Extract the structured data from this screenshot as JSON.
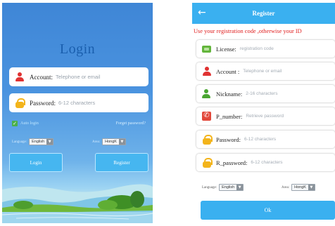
{
  "login": {
    "title": "Login",
    "account_label": "Account:",
    "account_placeholder": "Telephone or email",
    "password_label": "Password:",
    "password_placeholder": "6-12 characters",
    "auto_login": "Auto login",
    "forget_password": "Forget password?",
    "language_caption": "Language:",
    "language_value": "English",
    "area_caption": "Area:",
    "area_value": "HongK",
    "login_button": "Login",
    "register_button": "Register"
  },
  "register": {
    "title": "Register",
    "back_glyph": "←",
    "notice": "Use your registration code ,otherwise your ID",
    "fields": [
      {
        "label": "License:",
        "placeholder": "registration code",
        "icon": "license-icon"
      },
      {
        "label": "Account :",
        "placeholder": "Telephone or email",
        "icon": "person-icon"
      },
      {
        "label": "Nickname:",
        "placeholder": "2-16 characters",
        "icon": "nickname-person-icon"
      },
      {
        "label": "P_number:",
        "placeholder": "Retrieve password",
        "icon": "phone-icon"
      },
      {
        "label": "Password:",
        "placeholder": "6-12 characters",
        "icon": "lock-icon"
      },
      {
        "label": "R_password:",
        "placeholder": "6-12 characters",
        "icon": "lock-icon"
      }
    ],
    "language_caption": "Language:",
    "language_value": "English",
    "area_caption": "Area:",
    "area_value": "HongK",
    "ok_button": "Ok"
  },
  "colors": {
    "accent": "#3ab0f0",
    "notice_red": "#e02020",
    "login_bg": "#4a93df"
  }
}
